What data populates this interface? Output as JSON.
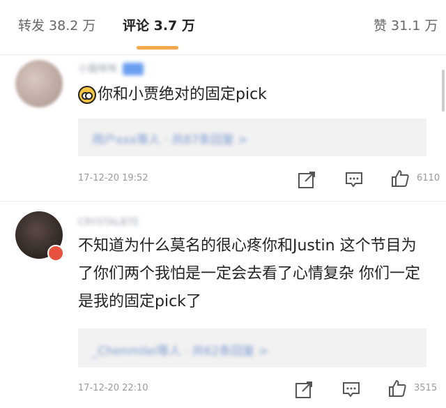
{
  "tabs": {
    "repost": "转发 38.2 万",
    "comment": "评论 3.7 万",
    "like": "赞 31.1 万"
  },
  "comments": [
    {
      "username": "小猫咪咪",
      "text": "你和小贾绝对的固定pick",
      "reply_preview": "用户xxx等人 · 共87条回复 >",
      "time": "17-12-20 19:52",
      "likes": "6110"
    },
    {
      "username": "CRYSTALBTE",
      "text": "不知道为什么莫名的很心疼你和Justin 这个节目为了你们两个我怕是一定会去看了心情复杂 你们一定是我的固定pick了",
      "reply_preview": "_Chenmilei等人 · 共62条回复 >",
      "time": "17-12-20 22:10",
      "likes": "3515"
    }
  ],
  "icons": {
    "share": "share-icon",
    "reply": "comment-icon",
    "like": "thumbs-up-icon"
  }
}
